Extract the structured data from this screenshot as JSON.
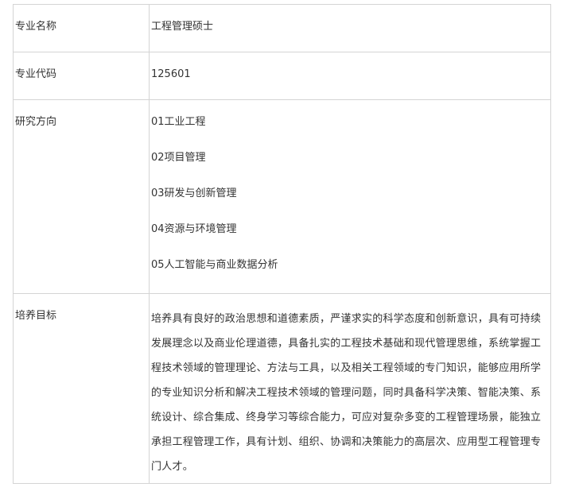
{
  "table": {
    "major_name": {
      "label": "专业名称",
      "value": "工程管理硕士"
    },
    "major_code": {
      "label": "专业代码",
      "value": "125601"
    },
    "research": {
      "label": "研究方向",
      "items": [
        "01工业工程",
        "02项目管理",
        "03研发与创新管理",
        "04资源与环境管理",
        "05人工智能与商业数据分析"
      ]
    },
    "goal": {
      "label": "培养目标",
      "value": "培养具有良好的政治思想和道德素质，严谨求实的科学态度和创新意识，具有可持续发展理念以及商业伦理道德，具备扎实的工程技术基础和现代管理思维，系统掌握工程技术领域的管理理论、方法与工具，以及相关工程领域的专门知识，能够应用所学的专业知识分析和解决工程技术领域的管理问题，同时具备科学决策、智能决策、系统设计、综合集成、终身学习等综合能力，可应对复杂多变的工程管理场景，能独立承担工程管理工作，具有计划、组织、协调和决策能力的高层次、应用型工程管理专门人才。"
    }
  }
}
